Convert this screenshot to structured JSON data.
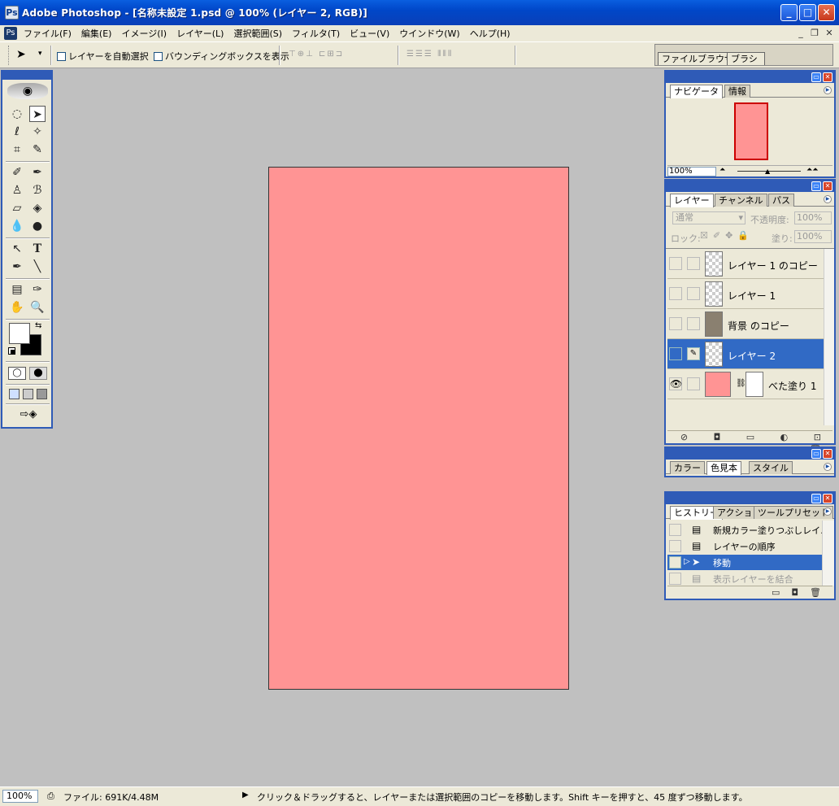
{
  "window": {
    "title": "Adobe Photoshop - [名称未設定 1.psd @ 100% (レイヤー 2, RGB)]",
    "minimize": "_",
    "maximize": "□",
    "close": "✕"
  },
  "menu": [
    "ファイル(F)",
    "編集(E)",
    "イメージ(I)",
    "レイヤー(L)",
    "選択範囲(S)",
    "フィルタ(T)",
    "ビュー(V)",
    "ウインドウ(W)",
    "ヘルプ(H)"
  ],
  "mdi": {
    "minimize": "_",
    "restore": "❐",
    "close": "✕"
  },
  "options": {
    "auto_select": "レイヤーを自動選択",
    "bounding_box": "バウンディングボックスを表示",
    "tool_arrow": "▾"
  },
  "well_tabs": [
    "ファイルブラウザ",
    "ブラシ"
  ],
  "navigator": {
    "tabs": [
      "ナビゲータ",
      "情報"
    ],
    "zoom": "100%",
    "zoom_out": "⏶",
    "zoom_in": "⏶⏶"
  },
  "layers": {
    "tabs": [
      "レイヤー",
      "チャンネル",
      "パス"
    ],
    "blend_mode": "通常",
    "opacity_label": "不透明度:",
    "opacity": "100%",
    "lock_label": "ロック:",
    "fill_label": "塗り:",
    "fill": "100%",
    "items": [
      {
        "name": "レイヤー 1 のコピー",
        "selected": false,
        "visible": false
      },
      {
        "name": "レイヤー 1",
        "selected": false,
        "visible": false
      },
      {
        "name": "背景 のコピー",
        "selected": false,
        "visible": false
      },
      {
        "name": "レイヤー 2",
        "selected": true,
        "visible": false
      },
      {
        "name": "べた塗り 1",
        "selected": false,
        "visible": true
      }
    ],
    "bottom_icons": "⊘ ◘ ▭ ◐ ⊡ 🗑"
  },
  "color": {
    "tabs": [
      "カラー",
      "色見本",
      "スタイル"
    ]
  },
  "history": {
    "tabs": [
      "ヒストリー",
      "アクション",
      "ツールプリセット"
    ],
    "items": [
      {
        "name": "新規カラー塗りつぶしレイ…",
        "state": "normal"
      },
      {
        "name": "レイヤーの順序",
        "state": "normal"
      },
      {
        "name": "移動",
        "state": "selected"
      },
      {
        "name": "表示レイヤーを結合",
        "state": "dimmed"
      }
    ]
  },
  "status": {
    "zoom": "100%",
    "file": "ファイル: 691K/4.48M",
    "hint": "クリック＆ドラッグすると、レイヤーまたは選択範囲のコピーを移動します。Shift キーを押すと、45 度ずつ移動します。"
  },
  "colors": {
    "document_fill": "#ff9494",
    "accent": "#316ac5",
    "title": "#0047c8"
  }
}
